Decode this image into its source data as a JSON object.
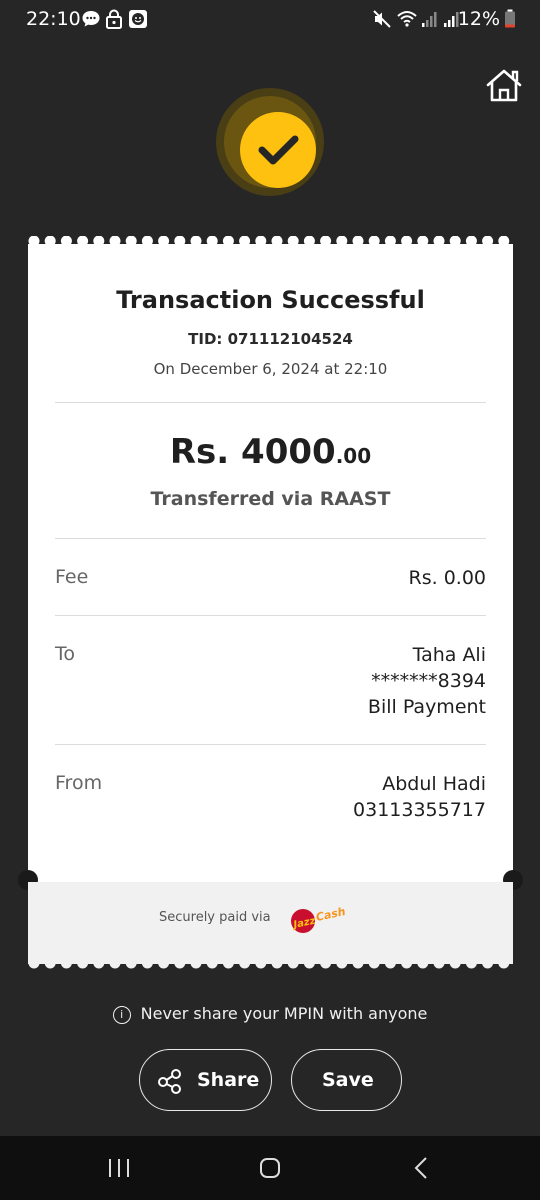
{
  "status_bar": {
    "time": "22:10",
    "battery": "12%"
  },
  "receipt": {
    "title": "Transaction Successful",
    "tid": "TID: 071112104524",
    "date": "On December 6, 2024 at 22:10",
    "amount_main": "Rs. 4000",
    "amount_decimal": ".00",
    "via": "Transferred via RAAST",
    "fee_label": "Fee",
    "fee_value": "Rs. 0.00",
    "to_label": "To",
    "to_name": "Taha Ali",
    "to_account": "*******8394",
    "to_purpose": "Bill Payment",
    "from_label": "From",
    "from_name": "Abdul Hadi",
    "from_number": "03113355717",
    "secure_text": "Securely paid via",
    "brand_logo_text": "JazzCash"
  },
  "mpin_notice": "Never share your MPIN with anyone",
  "actions": {
    "share": "Share",
    "save": "Save"
  },
  "colors": {
    "accent": "#fec10f",
    "background": "#262626",
    "brand_red": "#c8102e"
  }
}
